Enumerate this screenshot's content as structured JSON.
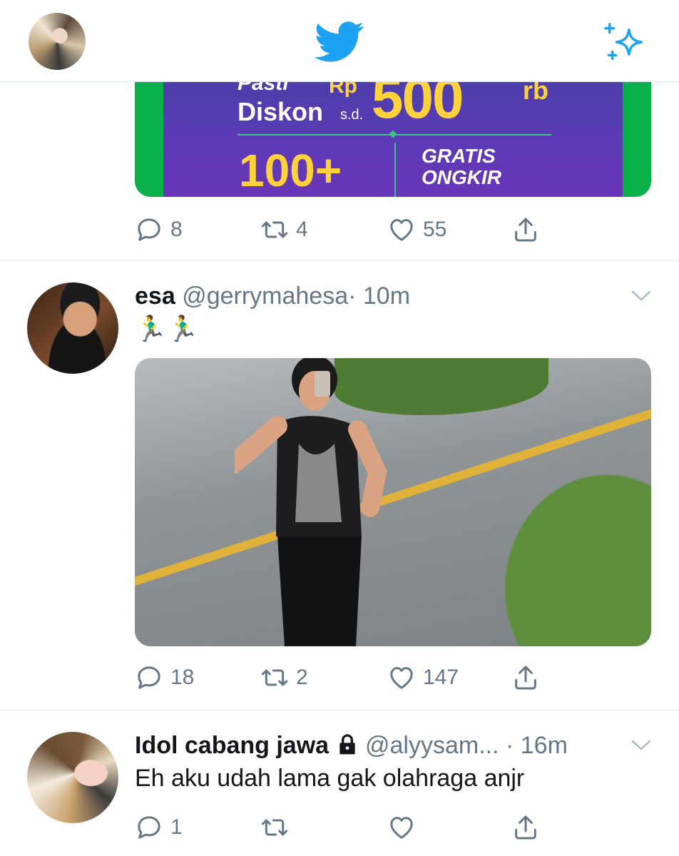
{
  "header": {
    "avatar_icon": "user-avatar",
    "logo_icon": "twitter-bird-icon",
    "sparkle_icon": "sparkle-icon"
  },
  "ad_tweet": {
    "promo": {
      "line1": "Pasti",
      "rp": "Rp",
      "line2": "Diskon",
      "sd": "s.d.",
      "amount": "500",
      "unit": "rb",
      "count": "100+",
      "gratis": "GRATIS",
      "ongkir": "ONGKIR"
    },
    "actions": {
      "replies": "8",
      "retweets": "4",
      "likes": "55"
    }
  },
  "tweets": [
    {
      "name": "esa",
      "handle": "@gerrymahesa",
      "time": "· 10m",
      "text": "🏃‍♂️🏃‍♂️",
      "actions": {
        "replies": "18",
        "retweets": "2",
        "likes": "147"
      }
    },
    {
      "name": "Idol cabang jawa",
      "handle": "@alyysam...",
      "time": "· 16m",
      "text": "Eh aku udah lama gak olahraga anjr",
      "actions": {
        "replies": "1",
        "retweets": "",
        "likes": ""
      }
    }
  ],
  "colors": {
    "brand_blue": "#1da1f2",
    "secondary_text": "#657786",
    "divider": "#e1e8ed"
  }
}
